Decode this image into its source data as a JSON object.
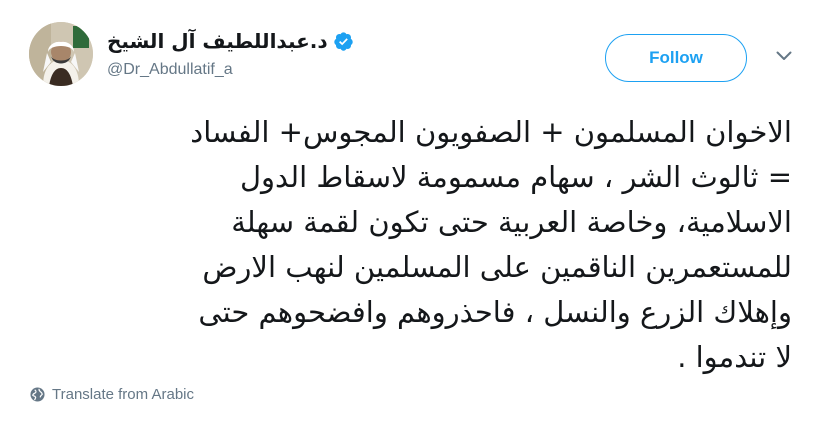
{
  "author": {
    "display_name": "د.عبداللطيف آل الشيخ",
    "handle": "@Dr_Abdullatif_a",
    "verified": true
  },
  "follow_label": "Follow",
  "tweet": {
    "lines": [
      "الاخوان المسلمون + الصفويون المجوس+ الفساد",
      "= ثالوث الشر ، سهام مسمومة لاسقاط الدول",
      "الاسلامية، وخاصة العربية حتى تكون لقمة سهلة",
      "للمستعمرين الناقمين على المسلمين لنهب الارض",
      "وإهلاك الزرع والنسل ، فاحذروهم وافضحوهم حتى",
      "لا تندموا ."
    ]
  },
  "translate_label": "Translate from Arabic",
  "icons": {
    "verified": "verified-badge-icon",
    "caret": "chevron-down-icon",
    "globe": "globe-icon"
  },
  "colors": {
    "accent": "#1da1f2",
    "text": "#14171a",
    "secondary": "#657786"
  }
}
